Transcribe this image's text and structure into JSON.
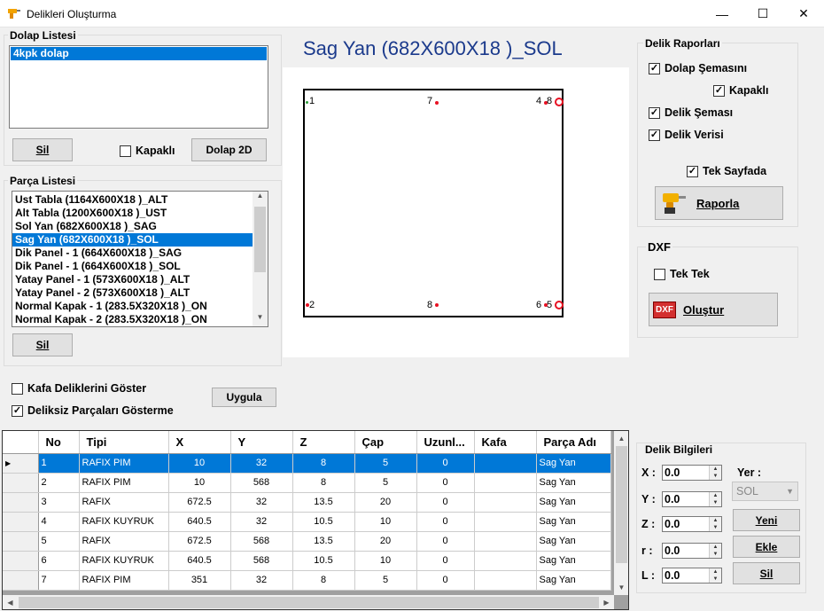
{
  "window": {
    "title": "Delikleri Oluşturma",
    "min": "—",
    "max": "☐",
    "close": "✕"
  },
  "dolap": {
    "title": "Dolap Listesi",
    "items": [
      "4kpk dolap"
    ],
    "sil": "Sil",
    "kapakli": "Kapaklı",
    "dolap2d": "Dolap 2D"
  },
  "parca": {
    "title": "Parça Listesi",
    "items": [
      "Ust Tabla (1164X600X18 )_ALT",
      "Alt Tabla (1200X600X18 )_UST",
      "Sol Yan (682X600X18 )_SAG",
      "Sag Yan (682X600X18 )_SOL",
      "Dik Panel - 1 (664X600X18 )_SAG",
      "Dik Panel - 1 (664X600X18 )_SOL",
      "Yatay Panel - 1 (573X600X18 )_ALT",
      "Yatay Panel - 2 (573X600X18 )_ALT",
      "Normal Kapak - 1 (283.5X320X18 )_ON",
      "Normal Kapak - 2 (283.5X320X18 )_ON"
    ],
    "sil": "Sil"
  },
  "options": {
    "kafa": "Kafa Deliklerini Göster",
    "deliksiz": "Deliksiz Parçaları Gösterme",
    "uygula": "Uygula"
  },
  "preview": {
    "title": "Sag Yan (682X600X18 )_SOL",
    "hole_labels": [
      "1",
      "7",
      "4",
      "8",
      "2",
      "8",
      "6",
      "5"
    ]
  },
  "rapor": {
    "title": "Delik Raporları",
    "dolap_semasi": "Dolap Şemasını",
    "kapakli": "Kapaklı",
    "delik_semasi": "Delik Şeması",
    "delik_verisi": "Delik Verisi",
    "tek_sayfada": "Tek Sayfada",
    "raporla": "Raporla"
  },
  "dxf": {
    "title": "DXF",
    "tek_tek": "Tek Tek",
    "icon_text": "DXF",
    "olustur": "Oluştur"
  },
  "table": {
    "columns": [
      "No",
      "Tipi",
      "X",
      "Y",
      "Z",
      "Çap",
      "Uzunl...",
      "Kafa",
      "Parça Adı"
    ],
    "rows": [
      [
        "1",
        "RAFIX PIM",
        "10",
        "32",
        "8",
        "5",
        "0",
        "",
        "Sag Yan"
      ],
      [
        "2",
        "RAFIX PIM",
        "10",
        "568",
        "8",
        "5",
        "0",
        "",
        "Sag Yan"
      ],
      [
        "3",
        "RAFIX",
        "672.5",
        "32",
        "13.5",
        "20",
        "0",
        "",
        "Sag Yan"
      ],
      [
        "4",
        "RAFIX KUYRUK",
        "640.5",
        "32",
        "10.5",
        "10",
        "0",
        "",
        "Sag Yan"
      ],
      [
        "5",
        "RAFIX",
        "672.5",
        "568",
        "13.5",
        "20",
        "0",
        "",
        "Sag Yan"
      ],
      [
        "6",
        "RAFIX KUYRUK",
        "640.5",
        "568",
        "10.5",
        "10",
        "0",
        "",
        "Sag Yan"
      ],
      [
        "7",
        "RAFIX PIM",
        "351",
        "32",
        "8",
        "5",
        "0",
        "",
        "Sag Yan"
      ]
    ]
  },
  "bilgi": {
    "title": "Delik Bilgileri",
    "x_label": "X :",
    "x_val": "0.0",
    "y_label": "Y :",
    "y_val": "0.0",
    "z_label": "Z :",
    "z_val": "0.0",
    "r_label": "r :",
    "r_val": "0.0",
    "l_label": "L :",
    "l_val": "0.0",
    "yer_label": "Yer :",
    "yer_val": "SOL",
    "yeni": "Yeni",
    "ekle": "Ekle",
    "sil": "Sil"
  },
  "colors": {
    "accent": "#0078d7",
    "hole": "#e81123",
    "green": "#2e9e3a"
  }
}
